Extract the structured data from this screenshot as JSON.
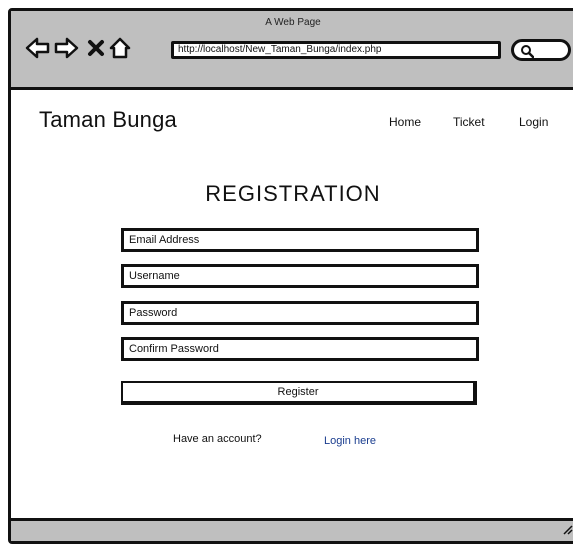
{
  "window": {
    "title": "A Web Page"
  },
  "browser": {
    "address": "http://localhost/New_Taman_Bunga/index.php",
    "icons": [
      "back-arrow-icon",
      "forward-arrow-icon",
      "close-x-icon",
      "home-icon",
      "search-icon",
      "resize-handle-icon"
    ]
  },
  "site": {
    "title": "Taman Bunga",
    "nav": {
      "home": "Home",
      "ticket": "Ticket",
      "login": "Login"
    }
  },
  "form": {
    "heading": "REGISTRATION",
    "email_placeholder": "Email Address",
    "username_placeholder": "Username",
    "password_placeholder": "Password",
    "confirm_placeholder": "Confirm Password",
    "register_label": "Register",
    "account_prompt": "Have an account?",
    "login_link": "Login here"
  }
}
